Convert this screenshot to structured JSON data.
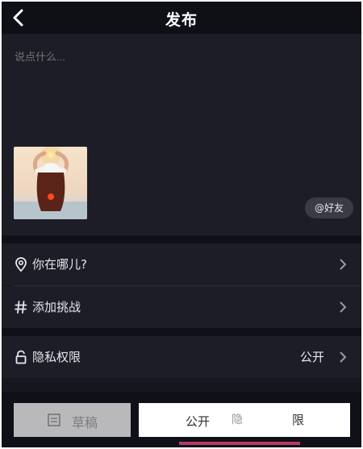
{
  "header": {
    "title": "发布"
  },
  "compose": {
    "caption_placeholder": "说点什么...",
    "mention_label": "@好友"
  },
  "rows": {
    "location": {
      "label": "你在哪儿?"
    },
    "challenge": {
      "label": "添加挑战"
    },
    "privacy": {
      "label": "隐私权限",
      "value": "公开"
    }
  },
  "bottom": {
    "draft_label": "草稿",
    "publish_label": "公开",
    "fragment_1": "隐",
    "fragment_2": "限"
  },
  "colors": {
    "background": "#16171f",
    "panel": "#1c1d26",
    "draft_button": "#b9b9bb",
    "accent_pink": "#e0457a"
  },
  "icons": [
    "back-icon",
    "location-pin-icon",
    "hashtag-icon",
    "lock-icon",
    "chevron-right-icon",
    "draft-icon"
  ]
}
